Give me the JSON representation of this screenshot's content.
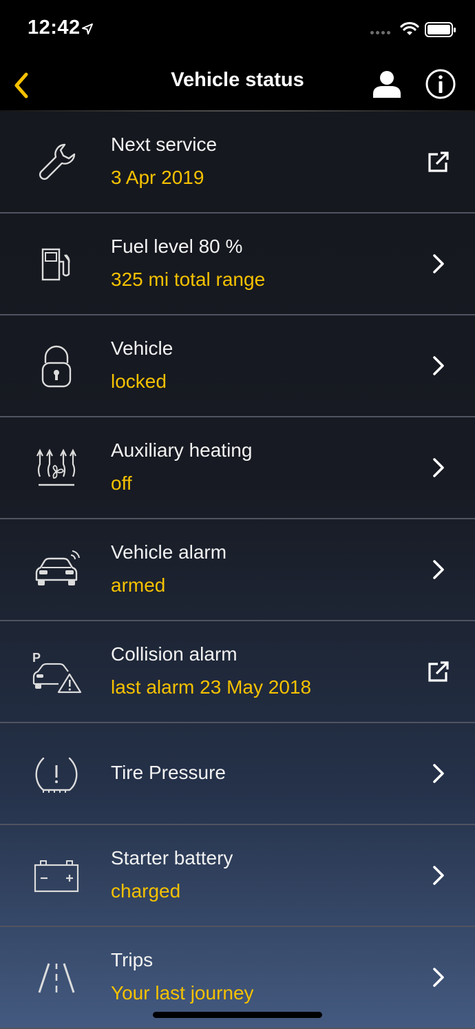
{
  "status_bar": {
    "time": "12:42"
  },
  "header": {
    "title": "Vehicle status"
  },
  "colors": {
    "accent": "#f5c100",
    "text": "#f2f2f2",
    "divider": "#505460"
  },
  "items": [
    {
      "title": "Next service",
      "subtitle": "3 Apr 2019",
      "icon": "wrench-icon",
      "action": "external-link-icon"
    },
    {
      "title": "Fuel level 80 %",
      "subtitle": "325 mi total range",
      "icon": "fuel-pump-icon",
      "action": "chevron-right-icon"
    },
    {
      "title": "Vehicle",
      "subtitle": "locked",
      "icon": "padlock-icon",
      "action": "chevron-right-icon"
    },
    {
      "title": "Auxiliary heating",
      "subtitle": "off",
      "icon": "heating-fan-icon",
      "action": "chevron-right-icon"
    },
    {
      "title": "Vehicle alarm",
      "subtitle": "armed",
      "icon": "car-alarm-icon",
      "action": "chevron-right-icon"
    },
    {
      "title": "Collision alarm",
      "subtitle": "last alarm 23 May 2018",
      "icon": "parked-car-warning-icon",
      "action": "external-link-icon"
    },
    {
      "title": "Tire Pressure",
      "subtitle": "",
      "icon": "tire-pressure-icon",
      "action": "chevron-right-icon"
    },
    {
      "title": "Starter battery",
      "subtitle": "charged",
      "icon": "battery-icon",
      "action": "chevron-right-icon"
    },
    {
      "title": "Trips",
      "subtitle": "Your last journey",
      "icon": "road-icon",
      "action": "chevron-right-icon"
    }
  ]
}
